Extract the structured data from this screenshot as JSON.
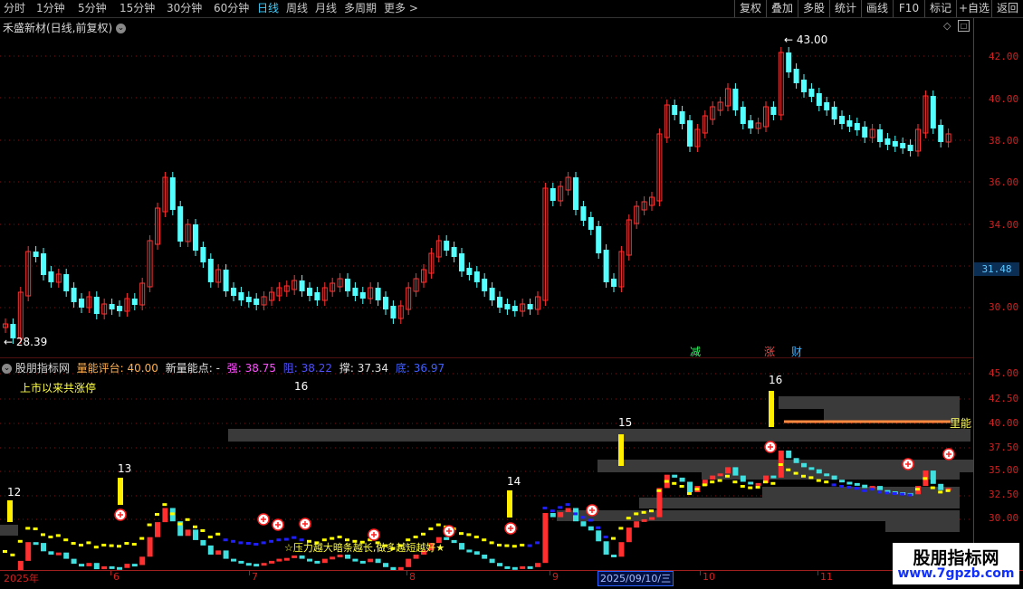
{
  "toolbar": {
    "periods": [
      "分时",
      "1分钟",
      "5分钟",
      "15分钟",
      "30分钟",
      "60分钟",
      "日线",
      "周线",
      "月线",
      "多周期",
      "更多 >"
    ],
    "active_period": "日线",
    "right_buttons": [
      "复权",
      "叠加",
      "多股",
      "统计",
      "画线",
      "F10",
      "标记",
      "+自选",
      "返回"
    ]
  },
  "main_chart": {
    "title": "禾盛新材(日线,前复权)",
    "y_ticks": [
      "42.00",
      "40.00",
      "38.00",
      "36.00",
      "34.00",
      "32.00",
      "30.00"
    ],
    "last_price": "31.48",
    "high_label": "43.00",
    "low_label": "28.39",
    "events": [
      {
        "text": "减",
        "color": "#33ff66"
      },
      {
        "text": "涨",
        "color": "#ff4040"
      },
      {
        "text": "财",
        "color": "#40b0ff"
      }
    ]
  },
  "indicator": {
    "name": "股朋指标网",
    "score_label": "量能评台: 40.00",
    "newpoint_label": "新量能点: -",
    "strong_label": "强: 38.75",
    "resist_label": "阻: 38.22",
    "swing_label": "撑: 37.34",
    "bottom_label": "底: 36.97",
    "limit_up_label": "上市以来共涨停",
    "limit_up_count": "16",
    "y_ticks": [
      "45.00",
      "42.50",
      "40.00",
      "37.50",
      "35.00",
      "32.50",
      "30.00"
    ],
    "numbers": [
      "12",
      "13",
      "14",
      "15",
      "16"
    ],
    "slogan": "☆压力越大暗条越长,做多越短越好★",
    "right_tag": "里能"
  },
  "xaxis": {
    "labels": [
      "2025年",
      "6",
      "7",
      "8",
      "9",
      "10",
      "11"
    ],
    "selected_date": "2025/09/10/三"
  },
  "watermark": {
    "name": "股朋指标网",
    "url": "www.7gpzb.com"
  },
  "colors": {
    "up": "#ff3232",
    "down": "#54ffff",
    "grid": "#801010",
    "axis": "#d02020",
    "yellow": "#ffff00",
    "blue": "#2020ff"
  }
}
